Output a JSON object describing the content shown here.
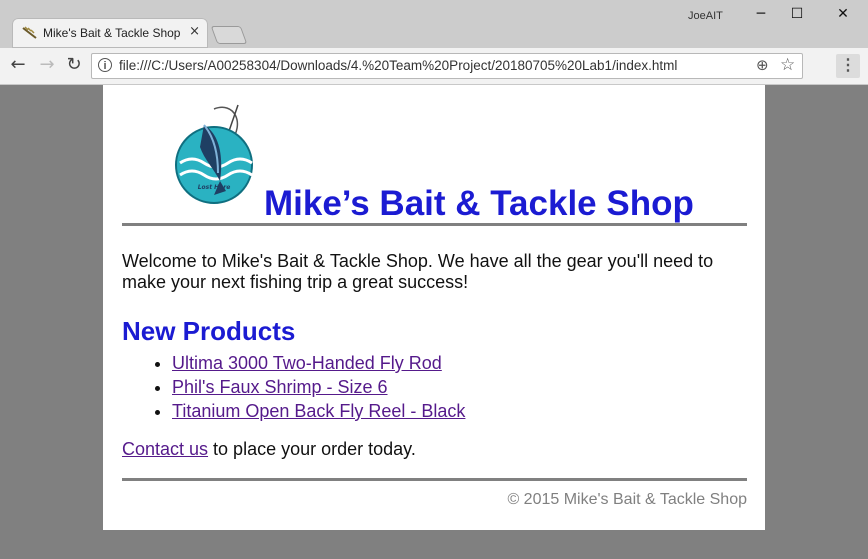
{
  "window": {
    "tab_title": "Mike's Bait & Tackle Shop",
    "tab_close": "×",
    "user_label": "JoeAIT",
    "minimize": "─",
    "maximize": "☐",
    "close": "✕"
  },
  "toolbar": {
    "back": "←",
    "forward": "→",
    "reload": "↻",
    "info": "i",
    "url": "file:///C:/Users/A00258304/Downloads/4.%20Team%20Project/20180705%20Lab1/index.html",
    "zoom": "⊕",
    "star": "☆",
    "menu": "⋮"
  },
  "page": {
    "title": "Mike’s Bait & Tackle Shop",
    "logo_caption": "Lost Here",
    "intro": "Welcome to Mike's Bait & Tackle Shop. We have all the gear you'll need to make your next fishing trip a great success!",
    "new_products_heading": "New Products",
    "products": [
      "Ultima 3000 Two-Handed Fly Rod",
      "Phil's Faux Shrimp - Size 6",
      "Titanium Open Back Fly Reel - Black"
    ],
    "contact_link": "Contact us",
    "contact_rest": " to place your order today.",
    "footer": "© 2015 Mike's Bait & Tackle Shop"
  },
  "colors": {
    "title_blue": "#1b1bd2",
    "visited_link": "#551a8b",
    "rule_gray": "#808080"
  }
}
